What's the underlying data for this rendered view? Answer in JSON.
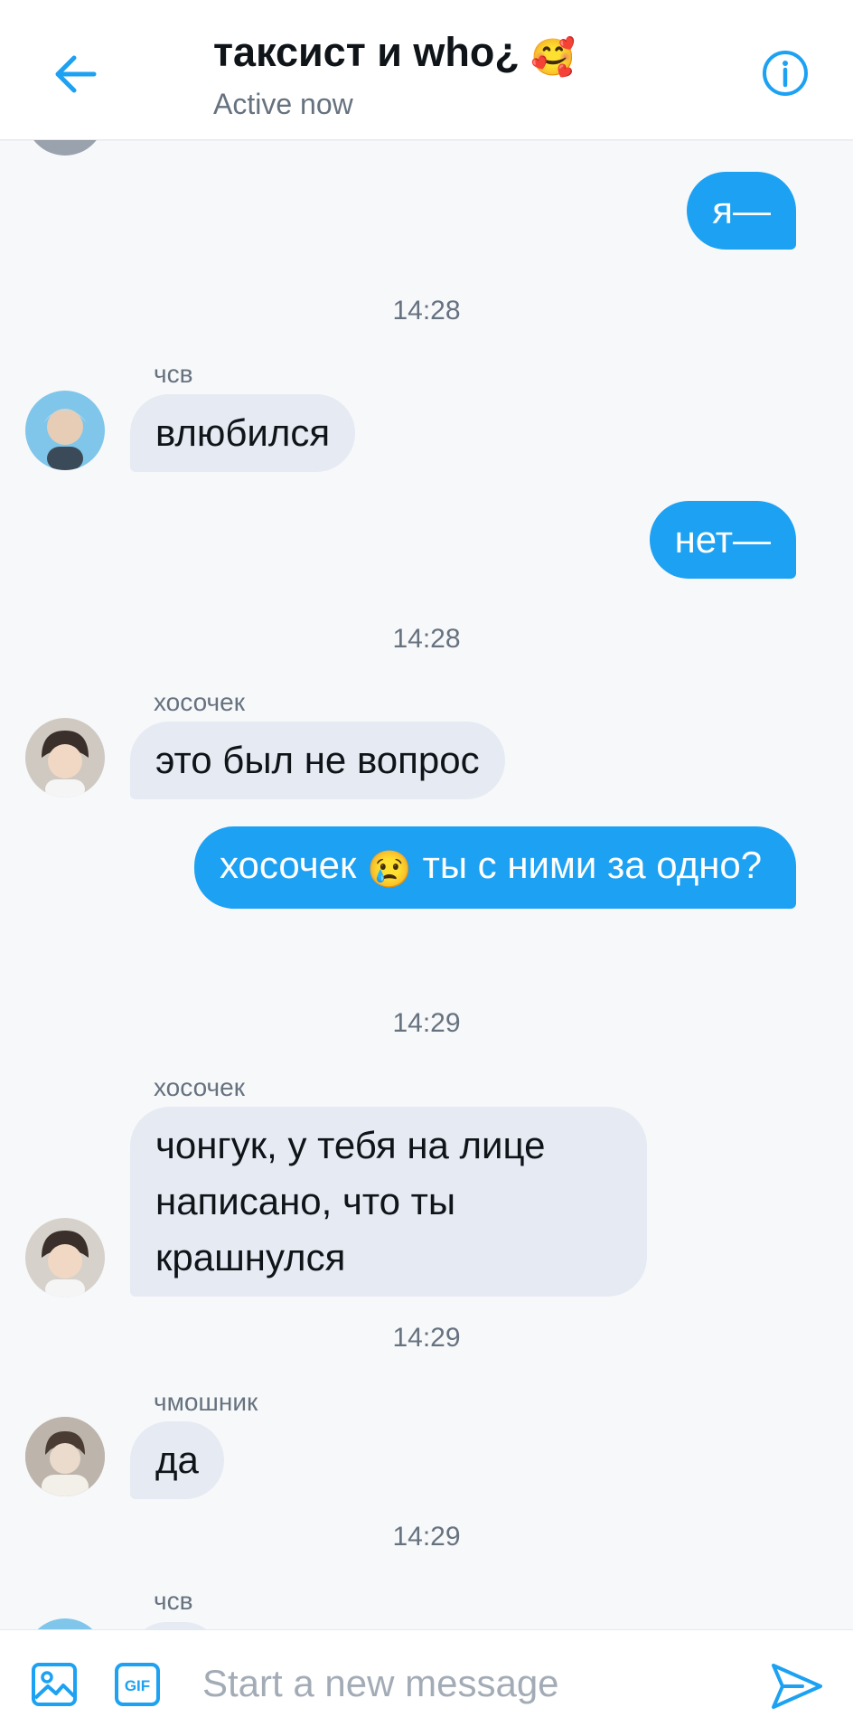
{
  "header": {
    "back_icon": "arrow-left-icon",
    "title_text": "таксист и who¿",
    "title_emoji": "🥰",
    "status": "Active now",
    "info_icon": "info-circle-icon"
  },
  "messages": [
    {
      "kind": "out",
      "text": "я—"
    },
    {
      "kind": "time",
      "text": "14:28"
    },
    {
      "kind": "in",
      "sender": "чсв",
      "text": "влюбился"
    },
    {
      "kind": "out",
      "text": "нет—"
    },
    {
      "kind": "time",
      "text": "14:28"
    },
    {
      "kind": "in",
      "sender": "хосочек",
      "text": "это был не вопрос"
    },
    {
      "kind": "out",
      "text_before": "хосочек",
      "emoji": "😢",
      "text_after": "ты с ними за одно?"
    },
    {
      "kind": "time",
      "text": "14:29"
    },
    {
      "kind": "in",
      "sender": "хосочек",
      "text": "чонгук, у тебя на лице написано, что ты крашнулся"
    },
    {
      "kind": "time",
      "text": "14:29"
    },
    {
      "kind": "in",
      "sender": "чмошник",
      "text": "да"
    },
    {
      "kind": "time",
      "text": "14:29"
    },
    {
      "kind": "in",
      "sender": "чсв",
      "text": ""
    }
  ],
  "composer": {
    "image_icon": "image-icon",
    "gif_icon": "gif-icon",
    "gif_label": "GIF",
    "placeholder": "Start a new message",
    "value": "",
    "send_icon": "send-icon"
  },
  "colors": {
    "accent": "#1da1f2",
    "incoming_bubble": "#e6eaf3",
    "muted_text": "#66727f",
    "background": "#f7f8fa"
  }
}
